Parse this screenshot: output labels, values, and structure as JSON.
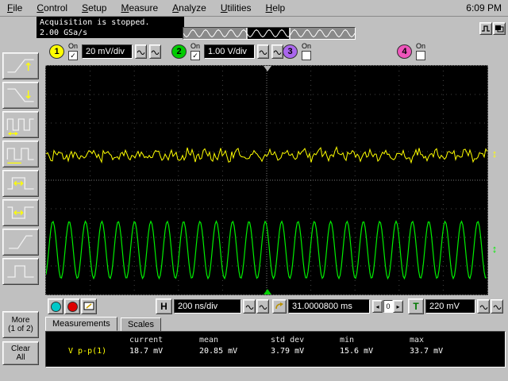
{
  "menu": {
    "items": [
      "File",
      "Control",
      "Setup",
      "Measure",
      "Analyze",
      "Utilities",
      "Help"
    ],
    "clock": "6:09 PM"
  },
  "status": {
    "line1": "Acquisition is stopped.",
    "line2": "2.00 GSa/s"
  },
  "channels": [
    {
      "num": "1",
      "on_label": "On",
      "enabled": true,
      "scale": "20 mV/div",
      "color": "#ffff00"
    },
    {
      "num": "2",
      "on_label": "On",
      "enabled": true,
      "scale": "1.00 V/div",
      "color": "#00cc00"
    },
    {
      "num": "3",
      "on_label": "On",
      "enabled": false,
      "color": "#aa66ee"
    },
    {
      "num": "4",
      "on_label": "On",
      "enabled": false,
      "color": "#ee55bb"
    }
  ],
  "sidebar": {
    "buttons": [
      {
        "icon": "rise-time-icon"
      },
      {
        "icon": "fall-time-icon"
      },
      {
        "icon": "frequency-icon"
      },
      {
        "icon": "period-icon"
      },
      {
        "icon": "positive-width-icon"
      },
      {
        "icon": "negative-width-icon"
      },
      {
        "icon": "rising-edge-icon"
      },
      {
        "icon": "pulse-icon"
      }
    ],
    "more_label": "More",
    "more_sub": "(1 of 2)",
    "clear_label": "Clear",
    "clear_sub": "All"
  },
  "horizontal": {
    "run_color": "#00c8c8",
    "stop_color": "#dd0000",
    "h_label": "H",
    "timebase": "200 ns/div",
    "position": "31.0000800 ms",
    "stepper": {
      "left": "◂",
      "value": "0",
      "right": "▸"
    },
    "trigger_label": "T",
    "trigger_color": "#007700",
    "trigger_level": "220 mV"
  },
  "tabs": [
    {
      "label": "Measurements"
    },
    {
      "label": "Scales"
    }
  ],
  "measurements": {
    "headers": [
      "current",
      "mean",
      "std dev",
      "min",
      "max"
    ],
    "rows": [
      {
        "label": "V p-p(1)",
        "color": "#ffff00",
        "values": [
          "18.7 mV",
          "20.85 mV",
          "3.79 mV",
          "15.6 mV",
          "33.7 mV"
        ]
      }
    ]
  },
  "chart_data": {
    "type": "line",
    "title": "oscilloscope display",
    "x_divisions": 10,
    "y_divisions": 8,
    "grid": true,
    "timebase": "200 ns/div",
    "sample_rate": "2.00 GSa/s",
    "series": [
      {
        "name": "channel 1",
        "color": "#ffff00",
        "scale": "20 mV/div",
        "waveform": "noisy",
        "center_frac": 0.39,
        "amplitude_frac": 0.035,
        "cycles": 27,
        "vpp_current": "18.7 mV"
      },
      {
        "name": "channel 2",
        "color": "#00ee00",
        "scale": "1.00 V/div",
        "waveform": "sine",
        "center_frac": 0.805,
        "amplitude_frac": 0.125,
        "cycles": 27
      }
    ]
  }
}
